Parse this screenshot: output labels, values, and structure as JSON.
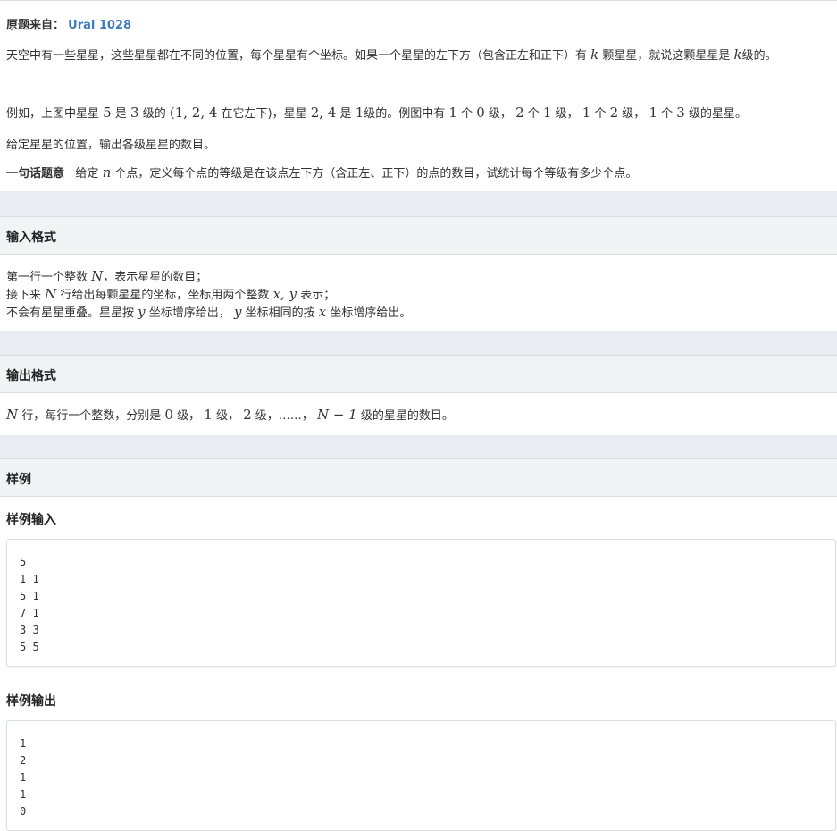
{
  "source": {
    "label": "原题来自：",
    "link": "Ural 1028"
  },
  "intro": {
    "p1_a": "天空中有一些星星，这些星星都在不同的位置，每个星星有个坐标。如果一个星星的左下方（包含正左和正下）有",
    "p1_k": "k",
    "p1_b": "颗星星，就说这颗星星是",
    "p1_k2": "k",
    "p1_c": "级的。",
    "p2_a": "例如，上图中星星",
    "p2_n5": "5",
    "p2_b": "是",
    "p2_n3": "3",
    "p2_c": "级的",
    "p2_set": "(1, 2, 4",
    "p2_d": "在它左下)，星星",
    "p2_pair": "2, 4",
    "p2_e": "是",
    "p2_n1": "1",
    "p2_f": "级的。例图中有",
    "p2_g1": "1",
    "p2_h1": "个",
    "p2_g2": "0",
    "p2_h2": "级，",
    "p2_g3": "2",
    "p2_h3": "个",
    "p2_g4": "1",
    "p2_h4": "级，",
    "p2_g5": "1",
    "p2_h5": "个",
    "p2_g6": "2",
    "p2_h6": "级，",
    "p2_g7": "1",
    "p2_h7": "个",
    "p2_g8": "3",
    "p2_h8": "级的星星。",
    "p3": "给定星星的位置，输出各级星星的数目。",
    "p4_label": "一句话题意",
    "p4_a": "给定",
    "p4_n": "n",
    "p4_b": "个点，定义每个点的等级是在该点左下方（含正左、正下）的点的数目，试统计每个等级有多少个点。"
  },
  "input_section": {
    "title": "输入格式",
    "l1_a": "第一行一个整数",
    "l1_N": "N",
    "l1_b": "，表示星星的数目；",
    "l2_a": "接下来",
    "l2_N": "N",
    "l2_b": "行给出每颗星星的坐标，坐标用两个整数",
    "l2_xy": "x, y",
    "l2_c": "表示；",
    "l3_a": "不会有星星重叠。星星按",
    "l3_y": "y",
    "l3_b": "坐标增序给出，",
    "l3_y2": "y",
    "l3_c": "坐标相同的按",
    "l3_x": "x",
    "l3_d": "坐标增序给出。"
  },
  "output_section": {
    "title": "输出格式",
    "N": "N",
    "a": "行，每行一个整数，分别是",
    "z": "0",
    "b": "级，",
    "o": "1",
    "c": "级，",
    "t": "2",
    "d": "级，……，",
    "expr": "N − 1",
    "e": "级的星星的数目。"
  },
  "sample_section": {
    "title": "样例",
    "input_label": "样例输入",
    "input_text": "5\n1 1\n5 1\n7 1\n3 3\n5 5",
    "output_label": "样例输出",
    "output_text": "1\n2\n1\n1\n0"
  }
}
